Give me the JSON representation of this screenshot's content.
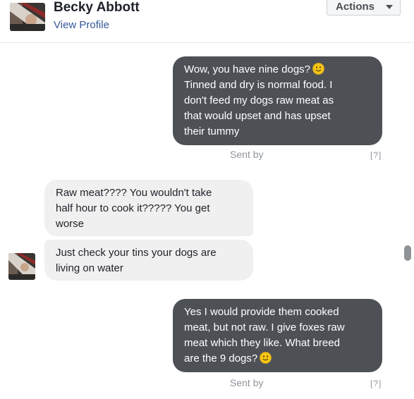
{
  "header": {
    "name": "Becky Abbott",
    "view_profile": "View Profile",
    "actions_label": "Actions"
  },
  "messages": [
    {
      "direction": "outgoing",
      "lines": [
        "Wow, you have nine dogs?",
        "Tinned and dry is normal food. I",
        "don't feed my dogs raw meat as",
        "that would upset and has upset",
        "their tummy"
      ]
    },
    {
      "direction": "incoming",
      "lines": [
        "Raw meat???? You wouldn't take",
        "half hour to cook it????? You get",
        "worse"
      ]
    },
    {
      "direction": "incoming",
      "lines": [
        "Just check your tins your dogs are",
        "living on water"
      ]
    },
    {
      "direction": "outgoing",
      "lines": [
        "Yes I would provide them cooked",
        "meat, but not raw. I give foxes raw",
        "meat which they like. What breed",
        "are the 9 dogs?"
      ]
    }
  ],
  "sent_by": "Sent by",
  "help_marker": "[?]",
  "colors": {
    "outgoing_bubble": "#4d5156",
    "incoming_bubble": "#f1f0f0",
    "link": "#365899",
    "emoji": "#f5c518"
  },
  "icons": [
    "smile-emoji-icon",
    "chevron-down-icon"
  ]
}
